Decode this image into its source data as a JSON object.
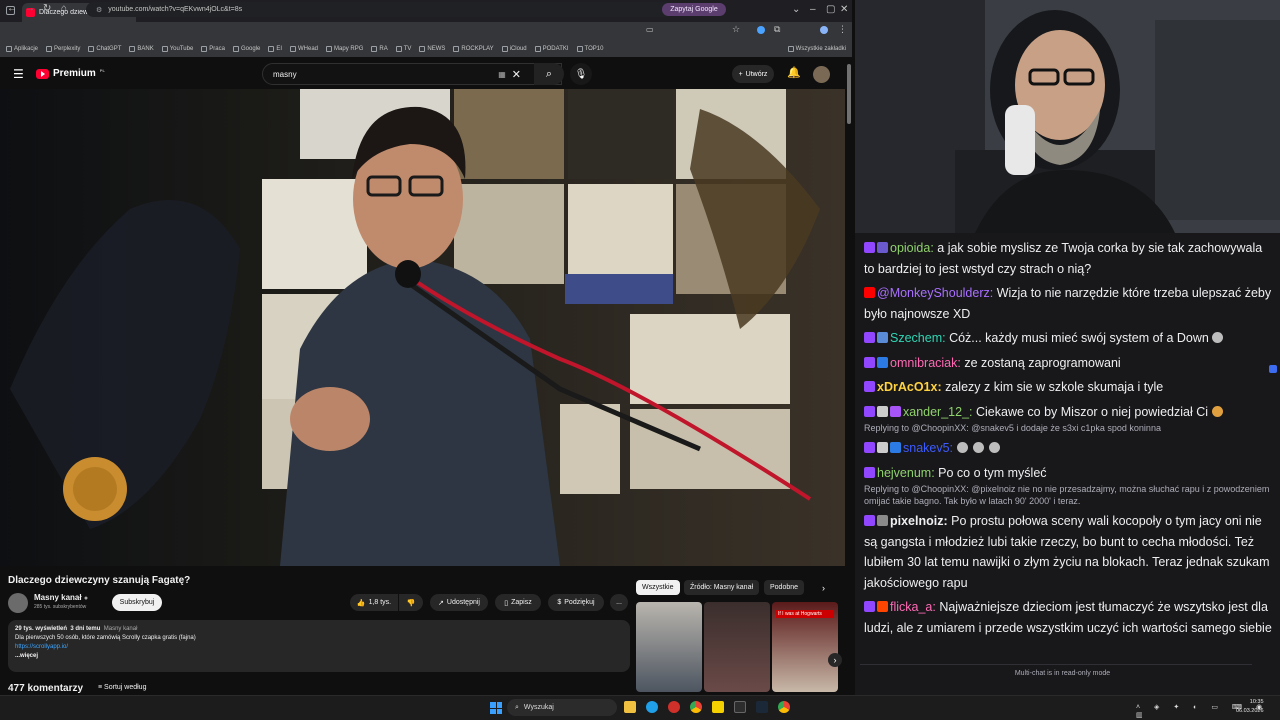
{
  "browser": {
    "tab_title": "Dlaczego dziewczyny szanuj",
    "url": "youtube.com/watch?v=qEKvwn4jOLc&t=8s",
    "ask_google": "Zapytaj Google",
    "bookmarks": [
      "Aplikacje",
      "Perplexity",
      "ChatGPT",
      "BANK",
      "YouTube",
      "Praca",
      "Google",
      "EI",
      "WHead",
      "Mapy RPG",
      "RA",
      "TV",
      "NEWS",
      "ROCKPLAY",
      "iCloud",
      "PODATKI",
      "TOP10"
    ],
    "all_bookmarks": "Wszystkie zakładki"
  },
  "youtube": {
    "logo": "Premium",
    "logo_region": "PL",
    "search_value": "masny",
    "create_label": "Utwórz",
    "video_title": "Dlaczego dziewczyny szanują Fagatę?",
    "channel_name": "Masny kanał",
    "subscribers": "285 tys. subskrybentów",
    "subscribe_label": "Subskrybuj",
    "likes": "1,8 tys.",
    "share_label": "Udostępnij",
    "save_label": "Zapisz",
    "thanks_label": "Podziękuj",
    "more_label": "...",
    "desc_meta_views": "29 tys. wyświetleń",
    "desc_meta_date": "3 dni temu",
    "desc_meta_channel": "Masny kanał",
    "desc_line": "Dla pierwszych 50 osób, które zamówią Scrolly czapka gratis (fajna)",
    "desc_link": "https://scrollyapp.io/",
    "desc_more": "...więcej",
    "comments_count": "477 komentarzy",
    "sort_label": "Sortuj według",
    "chips": [
      "Wszystkie",
      "Źródło: Masny kanał",
      "Podobne"
    ],
    "thumb_caption": "If I was at Hogwarts"
  },
  "chat": {
    "messages": [
      {
        "user": "opioida:",
        "color": "#8fd16c",
        "badges": [
          "#9147ff",
          "#6a5acd"
        ],
        "text": " a jak sobie myslisz ze Twoja corka by sie tak zachowywala to bardziej to jest wstyd czy strach o nią?"
      },
      {
        "user": "@MonkeyShoulderz:",
        "color": "#a970ff",
        "badges": [
          "#ff0000"
        ],
        "text": " Wizja to nie narzędzie które trzeba ulepszać żeby było najnowsze XD"
      },
      {
        "user": "Szechem:",
        "color": "#2ed6b4",
        "badges": [
          "#9147ff",
          "#5a8bd6"
        ],
        "text": " Cóż... każdy musi mieć swój system of a Down"
      },
      {
        "user": "omnibraciak:",
        "color": "#ff69b4",
        "badges": [
          "#9147ff",
          "#2c7be5"
        ],
        "text": " ze zostaną zaprogramowani"
      },
      {
        "user": "xDrAcO1x:",
        "color": "#ffd23f",
        "badges": [
          "#9147ff"
        ],
        "text": " zalezy z kim sie w szkole skumaja i tyle"
      },
      {
        "user": "xander_12_:",
        "color": "#8fd16c",
        "badges": [
          "#9147ff",
          "#cccccc",
          "#a855f7"
        ],
        "text": " Ciekawe co by Miszor o niej powiedział Ci"
      },
      {
        "reply": "Replying to @ChoopinXX: @snakev5 i dodaje że s3xi c1pka spod koninna"
      },
      {
        "user": "snakev5:",
        "color": "#3d5afe",
        "badges": [
          "#9147ff",
          "#cccccc",
          "#2c7be5"
        ],
        "text": ""
      },
      {
        "user": "hejvenum:",
        "color": "#8fd16c",
        "badges": [
          "#9147ff"
        ],
        "text": " Po co o tym myśleć"
      },
      {
        "reply": "Replying to @ChoopinXX: @pixelnoiz nie no nie przesadzajmy, można słuchać rapu i z powodzeniem omijać takie bagno. Tak było w latach 90' 2000' i teraz."
      },
      {
        "user": "pixelnoiz:",
        "color": "#efeff1",
        "badges": [
          "#9147ff",
          "#8a8a8a"
        ],
        "text": "  Po prostu połowa sceny wali kocopoły o tym jacy oni nie są gangsta i młodzież lubi takie rzeczy, bo bunt to cecha młodości. Też lubiłem 30 lat temu nawijki o złym życiu na blokach. Teraz jednak szukam jakościowego rapu"
      },
      {
        "user": "flicka_a:",
        "color": "#ff69b4",
        "badges": [
          "#9147ff",
          "#ff4500"
        ],
        "text": " Najważniejsze dzieciom jest tłumaczyć że wszytsko jest dla ludzi, ale z umiarem i przede wszystkim uczyć ich wartości samego siebie"
      }
    ],
    "footer": "Multi-chat is in read-only mode"
  },
  "taskbar": {
    "search_label": "Wyszukaj",
    "time": "10:35",
    "date": "06.03.2026"
  }
}
